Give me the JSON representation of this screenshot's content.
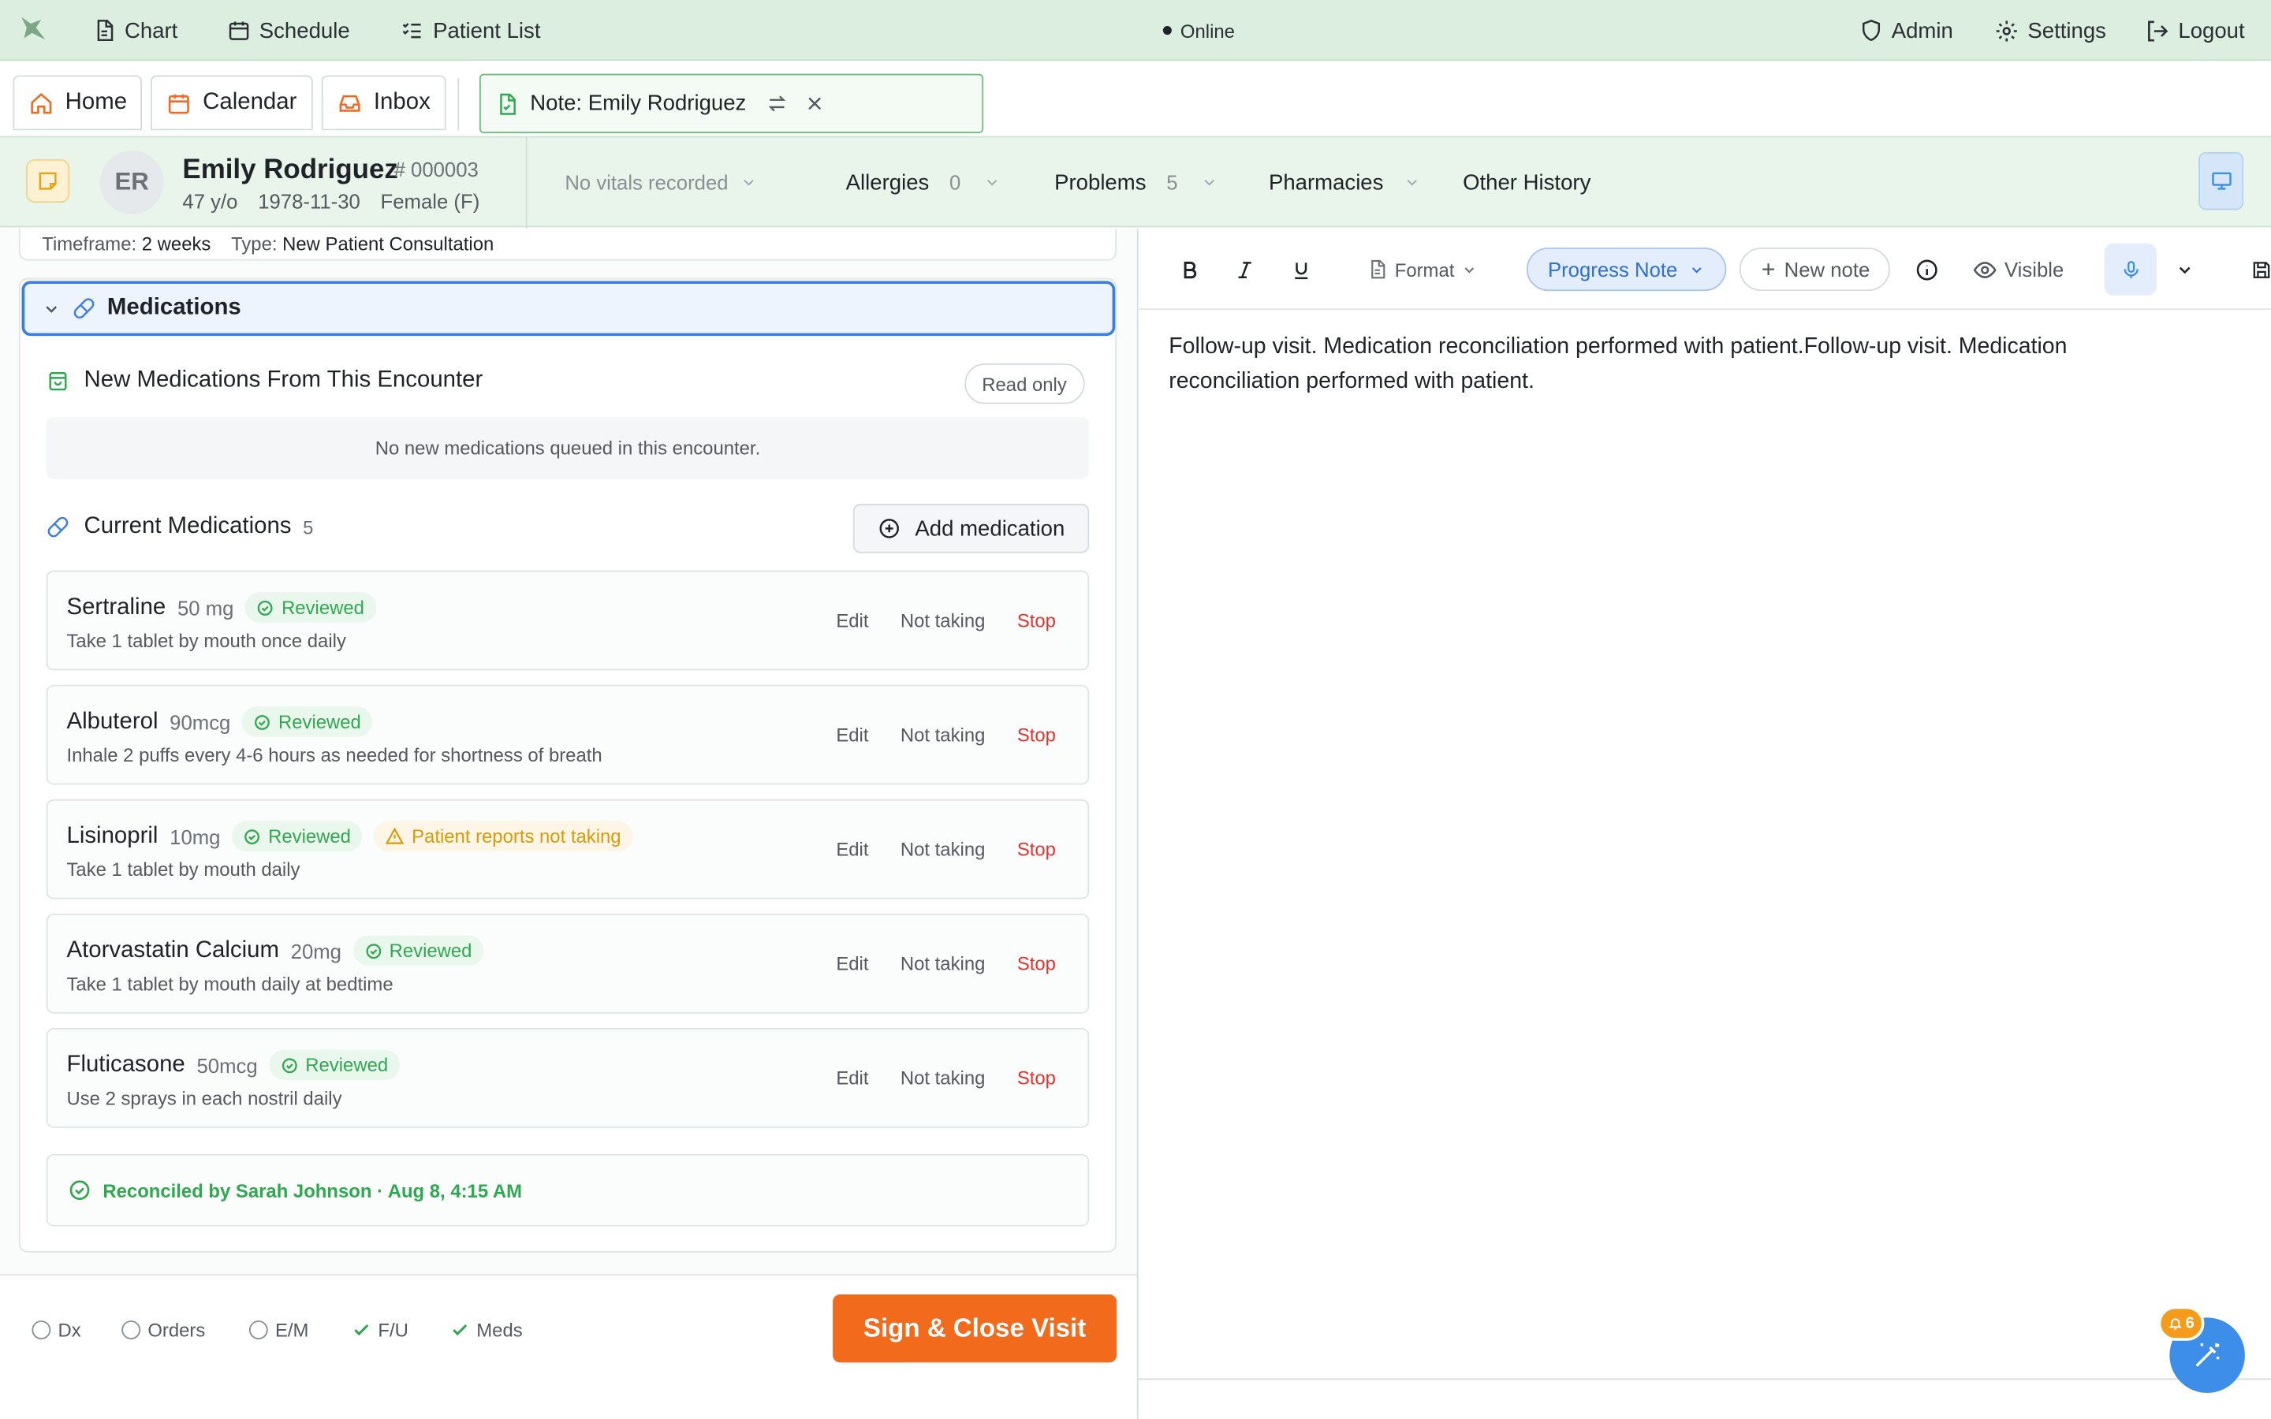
{
  "nav": {
    "chart": "Chart",
    "schedule": "Schedule",
    "patient_list": "Patient List",
    "status": "Online",
    "admin": "Admin",
    "settings": "Settings",
    "logout": "Logout"
  },
  "tabs": {
    "home": "Home",
    "calendar": "Calendar",
    "inbox": "Inbox",
    "active_note": "Note: Emily Rodriguez"
  },
  "patient": {
    "initials": "ER",
    "name": "Emily Rodriguez",
    "mrn": "# 000003",
    "age": "47 y/o",
    "dob": "1978-11-30",
    "sex": "Female (F)",
    "vitals": "No vitals recorded",
    "allergies_label": "Allergies",
    "allergies_count": "0",
    "problems_label": "Problems",
    "problems_count": "5",
    "pharmacies_label": "Pharmacies",
    "other_history_label": "Other History"
  },
  "visit": {
    "timeframe_label": "Timeframe:",
    "timeframe_value": "2 weeks",
    "type_label": "Type:",
    "type_value": "New Patient Consultation"
  },
  "medications": {
    "section_title": "Medications",
    "new_meds_title": "New Medications From This Encounter",
    "read_only": "Read only",
    "no_new_meds": "No new medications queued in this encounter.",
    "current_title": "Current Medications",
    "current_count": "5",
    "add_button": "Add medication",
    "actions": {
      "edit": "Edit",
      "not_taking": "Not taking",
      "stop": "Stop"
    },
    "items": [
      {
        "name": "Sertraline",
        "dose": "50 mg",
        "status": "Reviewed",
        "warning": "",
        "sig": "Take 1 tablet by mouth once daily"
      },
      {
        "name": "Albuterol",
        "dose": "90mcg",
        "status": "Reviewed",
        "warning": "",
        "sig": "Inhale 2 puffs every 4-6 hours as needed for shortness of breath"
      },
      {
        "name": "Lisinopril",
        "dose": "10mg",
        "status": "Reviewed",
        "warning": "Patient reports not taking",
        "sig": "Take 1 tablet by mouth daily"
      },
      {
        "name": "Atorvastatin Calcium",
        "dose": "20mg",
        "status": "Reviewed",
        "warning": "",
        "sig": "Take 1 tablet by mouth daily at bedtime"
      },
      {
        "name": "Fluticasone",
        "dose": "50mcg",
        "status": "Reviewed",
        "warning": "",
        "sig": "Use 2 sprays in each nostril daily"
      }
    ],
    "reconciled": "Reconciled by Sarah Johnson · Aug 8, 4:15 AM"
  },
  "footer": {
    "dx": "Dx",
    "orders": "Orders",
    "em": "E/M",
    "fu": "F/U",
    "meds": "Meds",
    "sign_button": "Sign & Close Visit"
  },
  "editor": {
    "format": "Format",
    "note_type": "Progress Note",
    "new_note": "New note",
    "visibility": "Visible",
    "content": "Follow-up visit. Medication reconciliation performed with patient.Follow-up visit. Medication reconciliation performed with patient."
  },
  "notifications": {
    "count": "6"
  },
  "colors": {
    "nav_bg": "#dceedf",
    "accent_blue": "#3d7fe0",
    "success": "#2fa84f",
    "warning": "#d99a0a",
    "danger": "#e0342f",
    "primary_action": "#f26b1d"
  }
}
